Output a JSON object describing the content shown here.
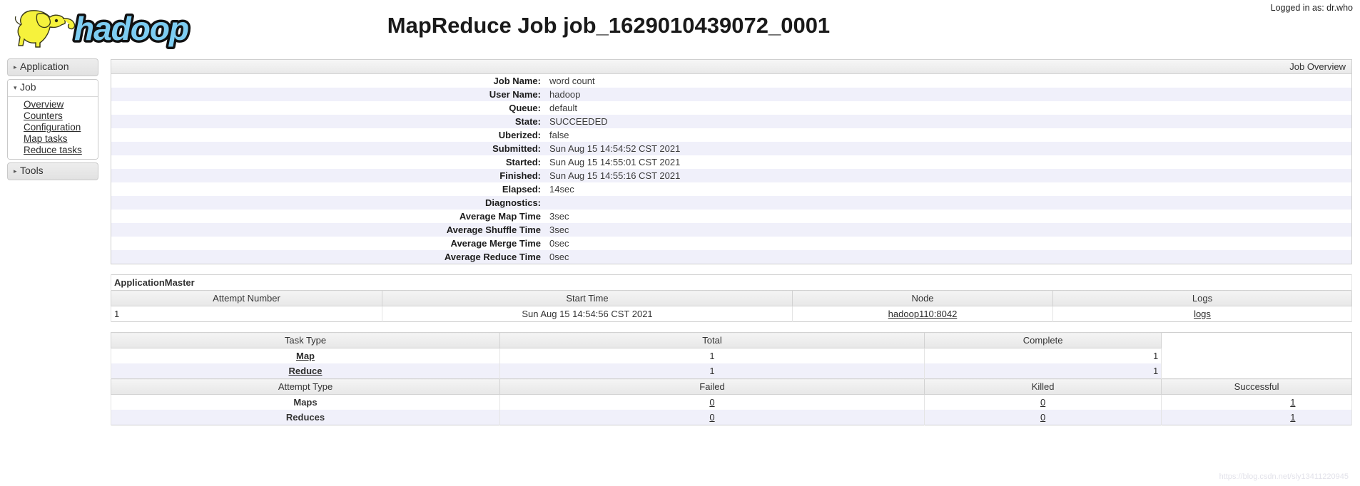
{
  "header": {
    "logo_alt": "hadoop",
    "login_status": "Logged in as: dr.who",
    "title": "MapReduce Job job_1629010439072_0001"
  },
  "sidebar": {
    "blocks": [
      {
        "label": "Application",
        "caret": "▸",
        "expanded": false,
        "items": []
      },
      {
        "label": "Job",
        "caret": "▾",
        "expanded": true,
        "items": [
          "Overview",
          "Counters",
          "Configuration",
          "Map tasks",
          "Reduce tasks"
        ]
      },
      {
        "label": "Tools",
        "caret": "▸",
        "expanded": false,
        "items": []
      }
    ]
  },
  "job_overview": {
    "caption": "Job Overview",
    "rows": [
      {
        "label": "Job Name:",
        "value": "word count"
      },
      {
        "label": "User Name:",
        "value": "hadoop"
      },
      {
        "label": "Queue:",
        "value": "default"
      },
      {
        "label": "State:",
        "value": "SUCCEEDED"
      },
      {
        "label": "Uberized:",
        "value": "false"
      },
      {
        "label": "Submitted:",
        "value": "Sun Aug 15 14:54:52 CST 2021"
      },
      {
        "label": "Started:",
        "value": "Sun Aug 15 14:55:01 CST 2021"
      },
      {
        "label": "Finished:",
        "value": "Sun Aug 15 14:55:16 CST 2021"
      },
      {
        "label": "Elapsed:",
        "value": "14sec"
      },
      {
        "label": "Diagnostics:",
        "value": ""
      },
      {
        "label": "Average Map Time",
        "value": "3sec"
      },
      {
        "label": "Average Shuffle Time",
        "value": "3sec"
      },
      {
        "label": "Average Merge Time",
        "value": "0sec"
      },
      {
        "label": "Average Reduce Time",
        "value": "0sec"
      }
    ]
  },
  "application_master": {
    "title": "ApplicationMaster",
    "columns": [
      "Attempt Number",
      "Start Time",
      "Node",
      "Logs"
    ],
    "rows": [
      {
        "attempt_number": "1",
        "start_time": "Sun Aug 15 14:54:56 CST 2021",
        "node": "hadoop110:8042",
        "logs": "logs"
      }
    ]
  },
  "task_summary": {
    "columns": [
      "Task Type",
      "Total",
      "Complete"
    ],
    "rows": [
      {
        "task_type": "Map",
        "total": "1",
        "complete": "1"
      },
      {
        "task_type": "Reduce",
        "total": "1",
        "complete": "1"
      }
    ],
    "attempt_columns": [
      "Attempt Type",
      "Failed",
      "Killed",
      "Successful"
    ],
    "attempt_rows": [
      {
        "attempt_type": "Maps",
        "failed": "0",
        "killed": "0",
        "successful": "1"
      },
      {
        "attempt_type": "Reduces",
        "failed": "0",
        "killed": "0",
        "successful": "1"
      }
    ]
  },
  "watermark": "https://blog.csdn.net/sly13411220945",
  "colors": {
    "row_alt": "#f0f0fa",
    "border": "#cfcfcf",
    "logo_blue": "#7dcdf2",
    "logo_yellow": "#f6f23c"
  }
}
